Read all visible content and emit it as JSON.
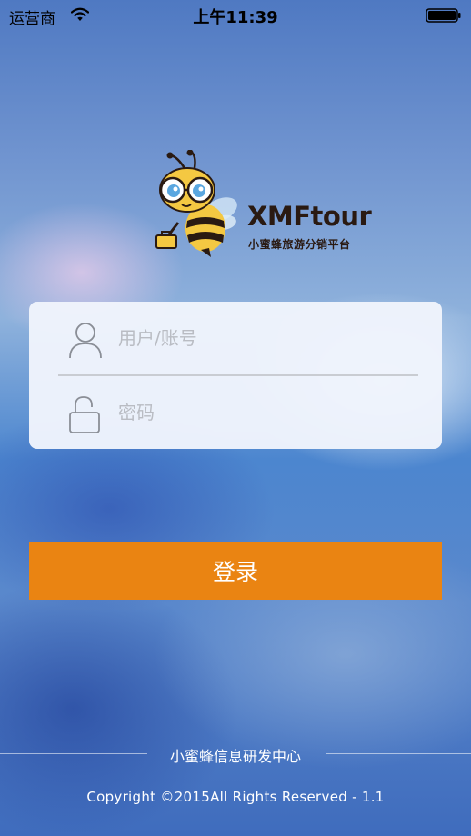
{
  "status_bar": {
    "carrier": "运营商",
    "time": "上午11:39",
    "wifi_icon": "wifi-icon",
    "battery_icon": "battery-icon"
  },
  "logo": {
    "icon": "bee-mascot-icon",
    "brand_name": "XMFtour",
    "brand_subtitle": "小蜜蜂旅游分销平台"
  },
  "login_form": {
    "username": {
      "icon": "user-icon",
      "placeholder": "用户/账号",
      "value": ""
    },
    "password": {
      "icon": "lock-icon",
      "placeholder": "密码",
      "value": ""
    },
    "submit_label": "登录"
  },
  "footer": {
    "organization": "小蜜蜂信息研发中心",
    "copyright": "Copyright ©2015All Rights Reserved - 1.1"
  },
  "colors": {
    "accent": "#ea8412",
    "card_background": "#f0f4fc",
    "placeholder_text": "#b9bcc3"
  }
}
